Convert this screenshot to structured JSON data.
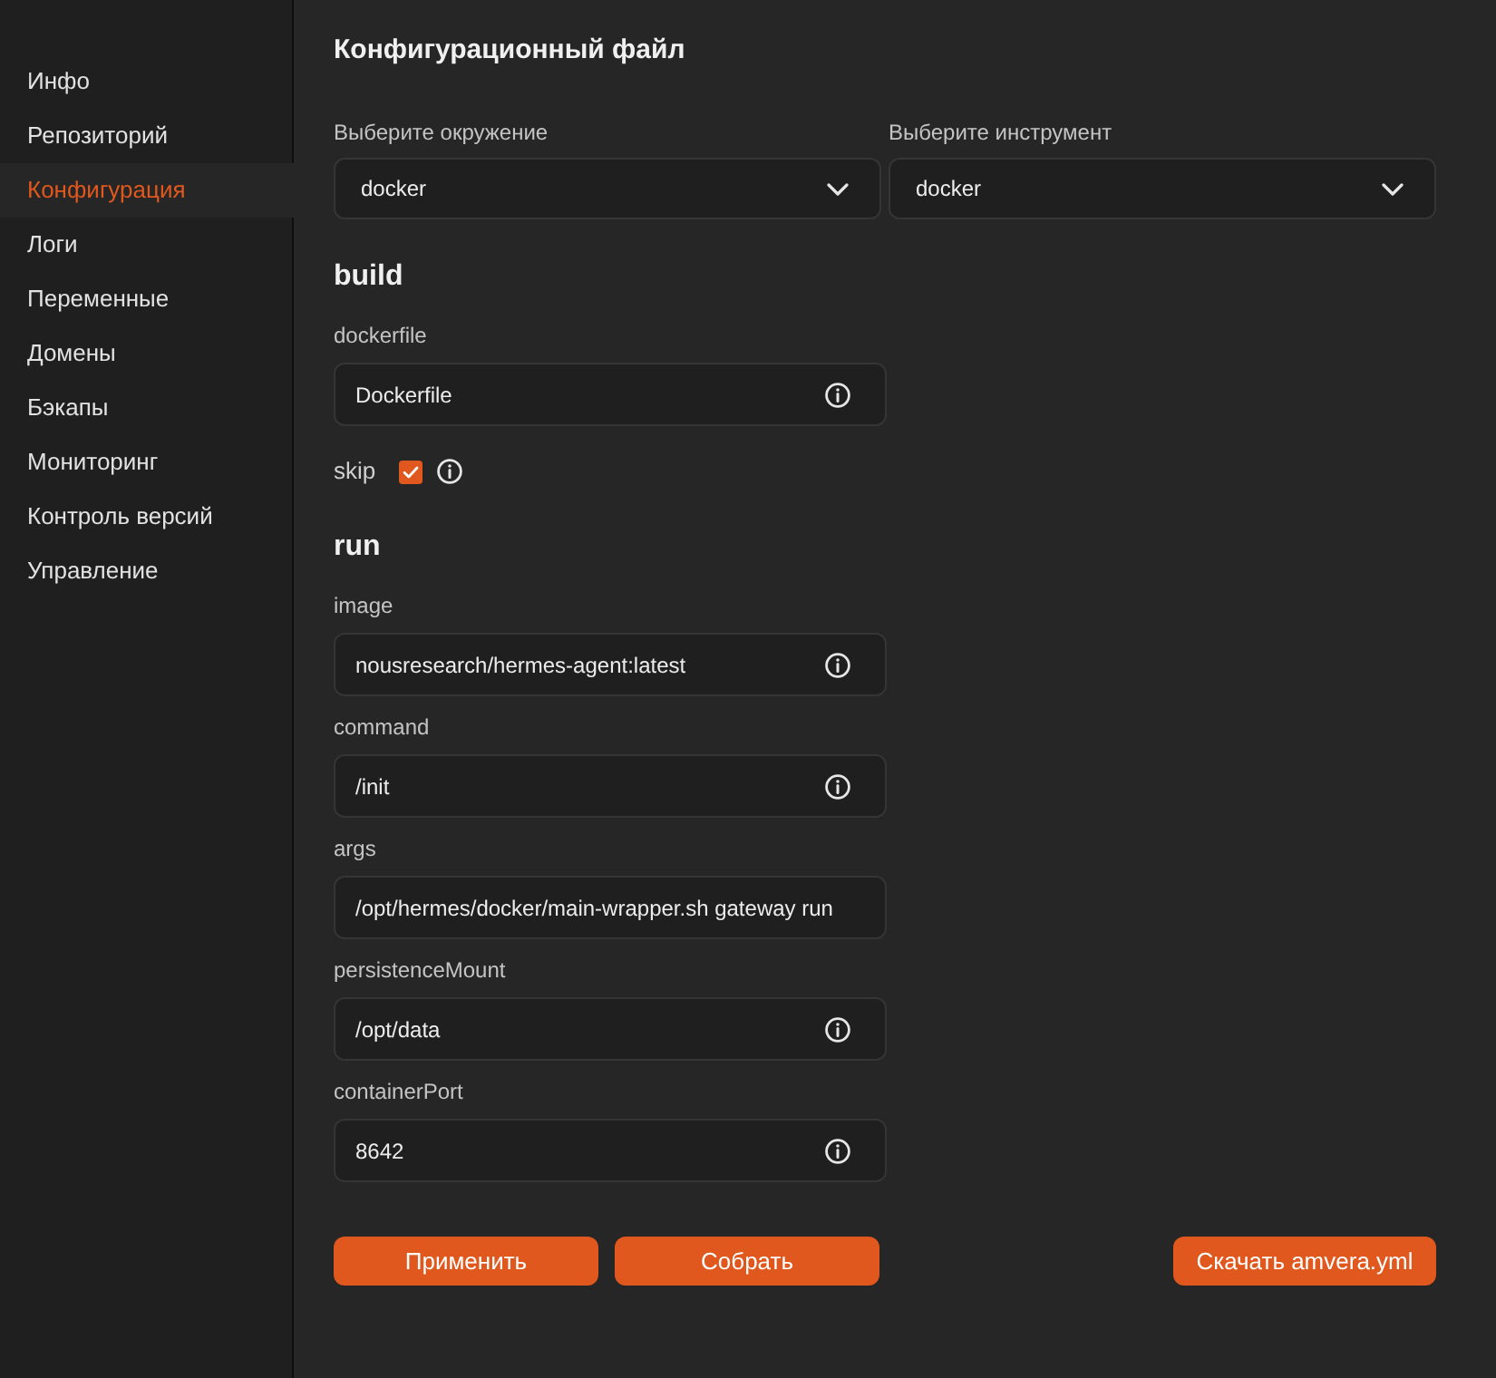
{
  "sidebar": {
    "items": [
      {
        "label": "Инфо",
        "selected": false
      },
      {
        "label": "Репозиторий",
        "selected": false
      },
      {
        "label": "Конфигурация",
        "selected": true
      },
      {
        "label": "Логи",
        "selected": false
      },
      {
        "label": "Переменные",
        "selected": false
      },
      {
        "label": "Домены",
        "selected": false
      },
      {
        "label": "Бэкапы",
        "selected": false
      },
      {
        "label": "Мониторинг",
        "selected": false
      },
      {
        "label": "Контроль версий",
        "selected": false
      },
      {
        "label": "Управление",
        "selected": false
      }
    ]
  },
  "main": {
    "title": "Конфигурационный файл",
    "selects": [
      {
        "label": "Выберите окружение",
        "value": "docker"
      },
      {
        "label": "Выберите инструмент",
        "value": "docker"
      }
    ],
    "sections": [
      {
        "title": "build",
        "fields": [
          {
            "kind": "input",
            "label": "dockerfile",
            "value": "Dockerfile",
            "info": true
          },
          {
            "kind": "checkbox",
            "label": "skip",
            "checked": true,
            "info": true
          }
        ]
      },
      {
        "title": "run",
        "fields": [
          {
            "kind": "input",
            "label": "image",
            "value": "nousresearch/hermes-agent:latest",
            "info": true
          },
          {
            "kind": "input",
            "label": "command",
            "value": "/init",
            "info": true
          },
          {
            "kind": "input",
            "label": "args",
            "value": "/opt/hermes/docker/main-wrapper.sh gateway run",
            "info": false
          },
          {
            "kind": "input",
            "label": "persistenceMount",
            "value": "/opt/data",
            "info": true
          },
          {
            "kind": "input",
            "label": "containerPort",
            "value": "8642",
            "info": true
          }
        ]
      }
    ],
    "actions": {
      "left": [
        "Применить",
        "Собрать"
      ],
      "right": [
        "Скачать amvera.yml"
      ]
    }
  }
}
